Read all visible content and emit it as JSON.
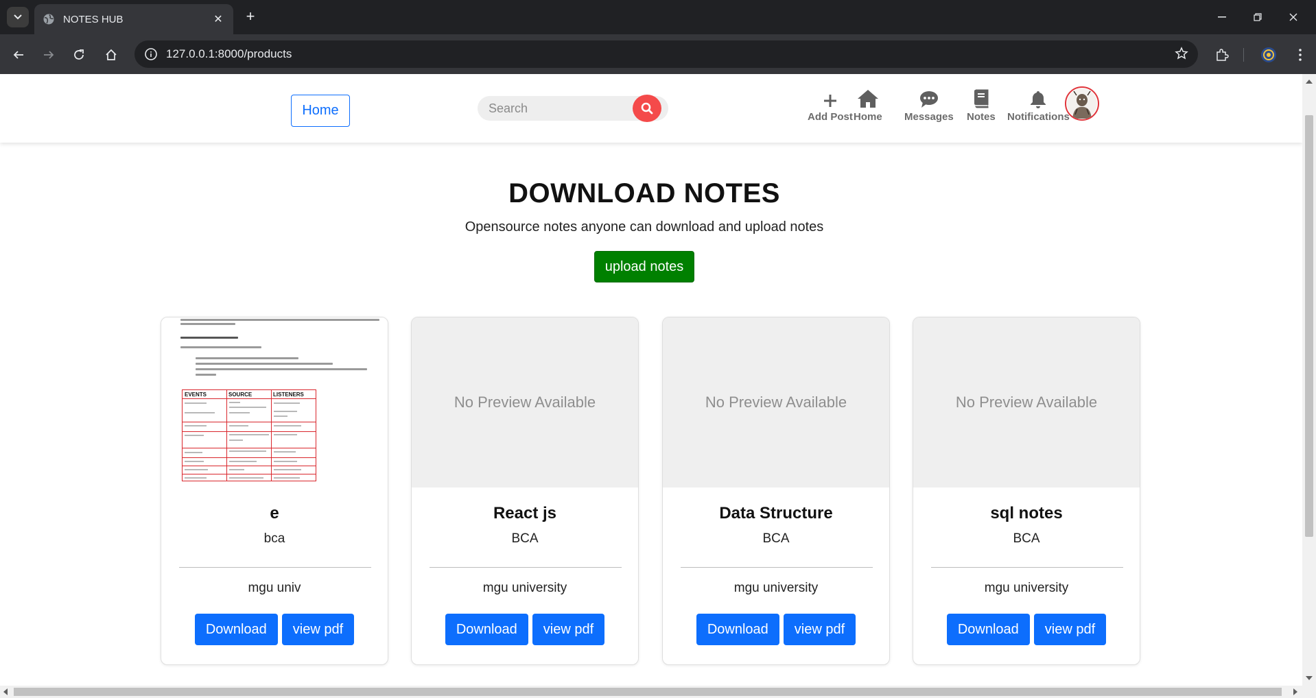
{
  "browser": {
    "tab_title": "NOTES HUB",
    "url": "127.0.0.1:8000/products"
  },
  "navbar": {
    "home_button": "Home",
    "search_placeholder": "Search",
    "items": [
      {
        "label": "Add Post",
        "icon": "plus-icon"
      },
      {
        "label": "Home",
        "icon": "house-icon"
      },
      {
        "label": "Messages",
        "icon": "chat-bubble-icon"
      },
      {
        "label": "Notes",
        "icon": "book-icon"
      },
      {
        "label": "Notifications",
        "icon": "bell-icon"
      }
    ]
  },
  "hero": {
    "title": "DOWNLOAD NOTES",
    "subtitle": "Opensource notes anyone can download and upload notes",
    "upload_button": "upload notes"
  },
  "cards": [
    {
      "title": "e",
      "course": "bca",
      "university": "mgu univ",
      "preview": "",
      "download": "Download",
      "view": "view pdf"
    },
    {
      "title": "React js",
      "course": "BCA",
      "university": "mgu university",
      "preview": "No Preview Available",
      "download": "Download",
      "view": "view pdf"
    },
    {
      "title": "Data Structure",
      "course": "BCA",
      "university": "mgu university",
      "preview": "No Preview Available",
      "download": "Download",
      "view": "view pdf"
    },
    {
      "title": "sql notes",
      "course": "BCA",
      "university": "mgu university",
      "preview": "No Preview Available",
      "download": "Download",
      "view": "view pdf"
    }
  ],
  "doc_preview": {
    "heading": "Components of Event Handling",
    "table_headers": [
      "EVENTS",
      "SOURCE",
      "LISTENERS"
    ]
  },
  "colors": {
    "primary": "#0d6efd",
    "upload": "#008000",
    "search_button": "#f44a4a"
  }
}
